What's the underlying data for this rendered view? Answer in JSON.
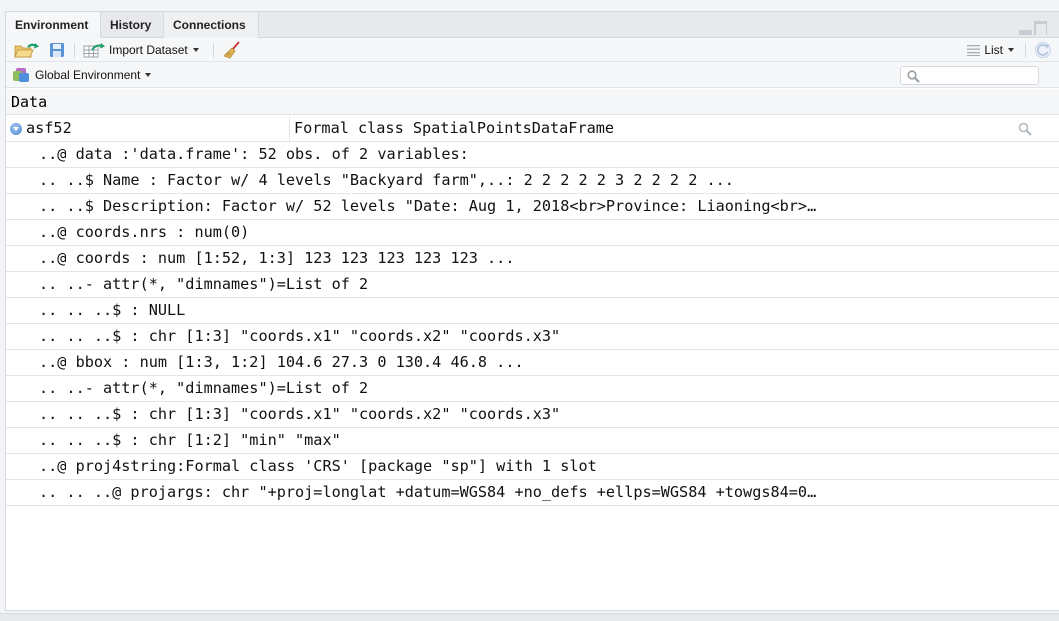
{
  "tabs": [
    {
      "label": "Environment",
      "active": true
    },
    {
      "label": "History",
      "active": false
    },
    {
      "label": "Connections",
      "active": false
    }
  ],
  "toolbar": {
    "load_icon": "folder-open-arrow-icon",
    "save_icon": "floppy-disk-icon",
    "import_label": "Import Dataset",
    "clear_icon": "broom-icon",
    "view_mode_label": "List",
    "refresh_icon": "refresh-icon"
  },
  "environment": {
    "selected": "Global Environment",
    "search_placeholder": ""
  },
  "section": {
    "title": "Data"
  },
  "object": {
    "name": "asf52",
    "value": "Formal class SpatialPointsDataFrame",
    "expanded": true
  },
  "details": [
    "..@ data :'data.frame': 52 obs. of 2 variables:",
    ".. ..$ Name : Factor w/ 4 levels \"Backyard farm\",..: 2 2 2 2 2 3 2 2 2 2 ...",
    ".. ..$ Description: Factor w/ 52 levels \"Date: Aug 1, 2018<br>Province: Liaoning<br>…",
    "..@ coords.nrs : num(0)",
    "..@ coords : num [1:52, 1:3] 123 123 123 123 123 ...",
    ".. ..- attr(*, \"dimnames\")=List of 2",
    ".. .. ..$ : NULL",
    ".. .. ..$ : chr [1:3] \"coords.x1\" \"coords.x2\" \"coords.x3\"",
    "..@ bbox : num [1:3, 1:2] 104.6 27.3 0 130.4 46.8 ...",
    ".. ..- attr(*, \"dimnames\")=List of 2",
    ".. .. ..$ : chr [1:3] \"coords.x1\" \"coords.x2\" \"coords.x3\"",
    ".. .. ..$ : chr [1:2] \"min\" \"max\"",
    "..@ proj4string:Formal class 'CRS' [package \"sp\"] with 1 slot",
    ".. .. ..@ projargs: chr \"+proj=longlat +datum=WGS84 +no_defs +ellps=WGS84 +towgs84=0…"
  ]
}
